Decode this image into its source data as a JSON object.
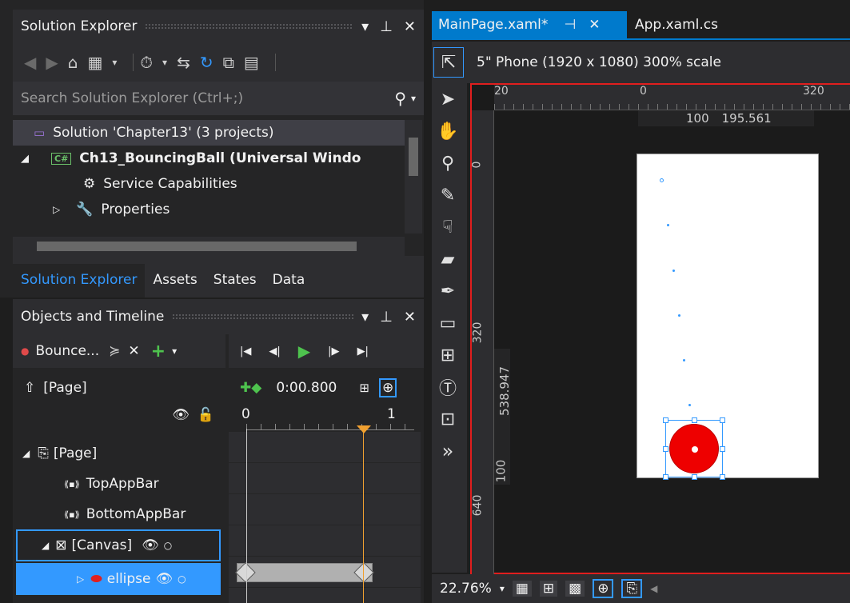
{
  "solution_explorer": {
    "title": "Solution Explorer",
    "search_placeholder": "Search Solution Explorer (Ctrl+;)",
    "tree": [
      {
        "label": "Solution 'Chapter13' (3 projects)"
      },
      {
        "label": "Ch13_BouncingBall (Universal Windo"
      },
      {
        "label": "Service Capabilities"
      },
      {
        "label": "Properties"
      }
    ],
    "bottom_tabs": [
      "Solution Explorer",
      "Assets",
      "States",
      "Data"
    ]
  },
  "objects_timeline": {
    "title": "Objects and Timeline",
    "storyboard_name": "Bounce...",
    "scope_label": "[Page]",
    "time": "0:00.800",
    "ruler_ticks": [
      "0",
      "1"
    ],
    "playhead_seconds": 0.8,
    "tree": [
      {
        "label": "[Page]"
      },
      {
        "label": "TopAppBar"
      },
      {
        "label": "BottomAppBar"
      },
      {
        "label": "[Canvas]"
      },
      {
        "label": "ellipse"
      }
    ],
    "colors": {
      "selection": "#3399ff",
      "playhead": "#f0a030",
      "record_dot": "#e04a4a",
      "play": "#4ec34e"
    }
  },
  "editor": {
    "tabs": [
      {
        "label": "MainPage.xaml*",
        "active": true
      },
      {
        "label": "App.xaml.cs",
        "active": false
      }
    ],
    "device": "5\" Phone (1920 x 1080) 300% scale",
    "zoom": "22.76%",
    "ruler_top": [
      "20",
      "0",
      "320"
    ],
    "ruler_left": [
      "0",
      "320",
      "640"
    ],
    "size_hint_h": [
      "100",
      "195.561"
    ],
    "size_hint_v": [
      "538.947",
      "100"
    ],
    "ball_color": "#ee0000",
    "artboard_border_color": "#e01e1e"
  }
}
